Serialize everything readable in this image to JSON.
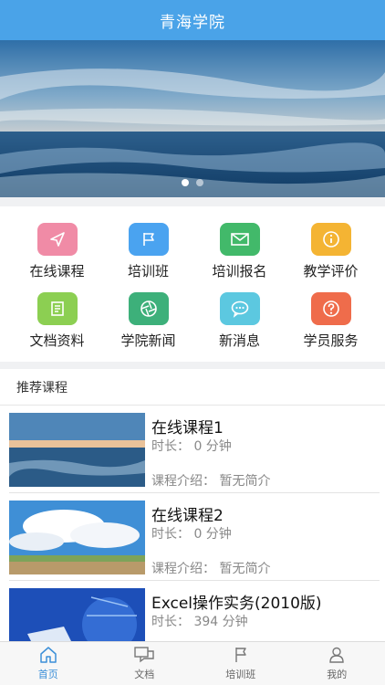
{
  "header": {
    "title": "青海学院"
  },
  "banner": {
    "slide_count": 2,
    "active_slide": 1
  },
  "grid": {
    "items": [
      {
        "label": "在线课程",
        "icon": "paper-plane-icon",
        "color": "#f08ba6"
      },
      {
        "label": "培训班",
        "icon": "flag-icon",
        "color": "#4aa3f0"
      },
      {
        "label": "培训报名",
        "icon": "mail-icon",
        "color": "#42b96a"
      },
      {
        "label": "教学评价",
        "icon": "info-icon",
        "color": "#f4b433"
      },
      {
        "label": "文档资料",
        "icon": "document-icon",
        "color": "#8ccf52"
      },
      {
        "label": "学院新闻",
        "icon": "aperture-icon",
        "color": "#3db07a"
      },
      {
        "label": "新消息",
        "icon": "chat-bubble-icon",
        "color": "#5cc8e0"
      },
      {
        "label": "学员服务",
        "icon": "question-icon",
        "color": "#ef6c4b"
      }
    ]
  },
  "recommend": {
    "heading": "推荐课程"
  },
  "courses": [
    {
      "title": "在线课程1",
      "duration": "时长：  0 分钟",
      "intro": "课程介绍：  暂无简介"
    },
    {
      "title": "在线课程2",
      "duration": "时长：  0 分钟",
      "intro": "课程介绍：  暂无简介"
    },
    {
      "title": "Excel操作实务(2010版)",
      "duration": "时长：  394 分钟",
      "intro": ""
    }
  ],
  "tabs": [
    {
      "label": "首页",
      "icon": "home-icon",
      "active": true
    },
    {
      "label": "文档",
      "icon": "document-chat-icon",
      "active": false
    },
    {
      "label": "培训班",
      "icon": "flag-icon",
      "active": false
    },
    {
      "label": "我的",
      "icon": "user-icon",
      "active": false
    }
  ],
  "colors": {
    "primary": "#4aa3e8",
    "tab_active": "#3b8fd8"
  }
}
